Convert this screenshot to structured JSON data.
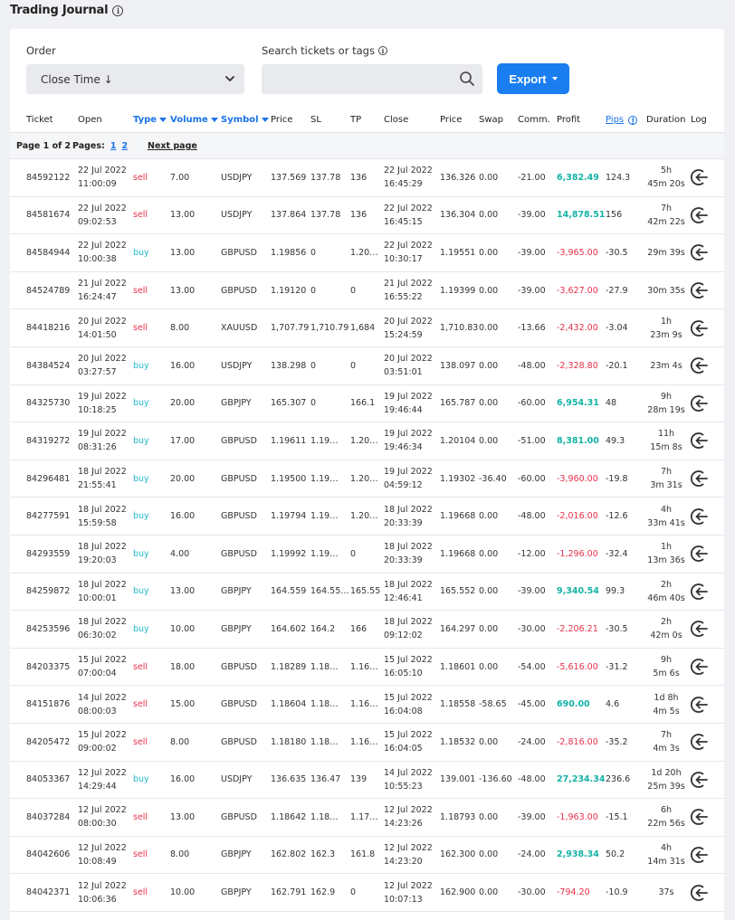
{
  "page": {
    "title": "Trading Journal"
  },
  "filters": {
    "order_label": "Order",
    "order_value": "Close Time ↓",
    "search_label": "Search tickets or tags",
    "search_value": "",
    "export_label": "Export"
  },
  "columns": {
    "ticket": "Ticket",
    "open": "Open",
    "type": "Type",
    "volume": "Volume",
    "symbol": "Symbol",
    "price": "Price",
    "sl": "SL",
    "tp": "TP",
    "close": "Close",
    "close_price": "Price",
    "swap": "Swap",
    "comm": "Comm.",
    "profit": "Profit",
    "pips": "Pips",
    "duration": "Duration",
    "log": "Log"
  },
  "pagination": {
    "info": "Page 1 of 2",
    "pages_label": "Pages:",
    "pages": [
      "1",
      "2"
    ],
    "next": "Next page"
  },
  "colors": {
    "accent": "#1a7ef0",
    "sell": "#e8304a",
    "buy": "#22b8c9",
    "profit_pos": "#14b3a5",
    "profit_neg": "#e8304a"
  },
  "trades": [
    {
      "ticket": "84592122",
      "open_date": "22 Jul 2022",
      "open_time": "11:00:09",
      "type": "sell",
      "volume": "7.00",
      "symbol": "USDJPY",
      "price": "137.569",
      "sl": "137.78",
      "tp": "136",
      "close_date": "22 Jul 2022",
      "close_time": "16:45:29",
      "close_price": "136.326",
      "swap": "0.00",
      "comm": "-21.00",
      "profit": "6,382.49",
      "pips": "124.3",
      "dur1": "5h",
      "dur2": "45m 20s"
    },
    {
      "ticket": "84581674",
      "open_date": "22 Jul 2022",
      "open_time": "09:02:53",
      "type": "sell",
      "volume": "13.00",
      "symbol": "USDJPY",
      "price": "137.864",
      "sl": "137.78",
      "tp": "136",
      "close_date": "22 Jul 2022",
      "close_time": "16:45:15",
      "close_price": "136.304",
      "swap": "0.00",
      "comm": "-39.00",
      "profit": "14,878.51",
      "pips": "156",
      "dur1": "7h",
      "dur2": "42m 22s"
    },
    {
      "ticket": "84584944",
      "open_date": "22 Jul 2022",
      "open_time": "10:00:38",
      "type": "buy",
      "volume": "13.00",
      "symbol": "GBPUSD",
      "price": "1.19856",
      "sl": "0",
      "tp": "1.20…",
      "close_date": "22 Jul 2022",
      "close_time": "10:30:17",
      "close_price": "1.19551",
      "swap": "0.00",
      "comm": "-39.00",
      "profit": "-3,965.00",
      "pips": "-30.5",
      "dur1": "29m 39s",
      "dur2": ""
    },
    {
      "ticket": "84524789",
      "open_date": "21 Jul 2022",
      "open_time": "16:24:47",
      "type": "sell",
      "volume": "13.00",
      "symbol": "GBPUSD",
      "price": "1.19120",
      "sl": "0",
      "tp": "0",
      "close_date": "21 Jul 2022",
      "close_time": "16:55:22",
      "close_price": "1.19399",
      "swap": "0.00",
      "comm": "-39.00",
      "profit": "-3,627.00",
      "pips": "-27.9",
      "dur1": "30m 35s",
      "dur2": ""
    },
    {
      "ticket": "84418216",
      "open_date": "20 Jul 2022",
      "open_time": "14:01:50",
      "type": "sell",
      "volume": "8.00",
      "symbol": "XAUUSD",
      "price": "1,707.79",
      "sl": "1,710.79",
      "tp": "1,684",
      "close_date": "20 Jul 2022",
      "close_time": "15:24:59",
      "close_price": "1,710.83",
      "swap": "0.00",
      "comm": "-13.66",
      "profit": "-2,432.00",
      "pips": "-3.04",
      "dur1": "1h",
      "dur2": "23m 9s"
    },
    {
      "ticket": "84384524",
      "open_date": "20 Jul 2022",
      "open_time": "03:27:57",
      "type": "buy",
      "volume": "16.00",
      "symbol": "USDJPY",
      "price": "138.298",
      "sl": "0",
      "tp": "0",
      "close_date": "20 Jul 2022",
      "close_time": "03:51:01",
      "close_price": "138.097",
      "swap": "0.00",
      "comm": "-48.00",
      "profit": "-2,328.80",
      "pips": "-20.1",
      "dur1": "23m 4s",
      "dur2": ""
    },
    {
      "ticket": "84325730",
      "open_date": "19 Jul 2022",
      "open_time": "10:18:25",
      "type": "buy",
      "volume": "20.00",
      "symbol": "GBPJPY",
      "price": "165.307",
      "sl": "0",
      "tp": "166.1",
      "close_date": "19 Jul 2022",
      "close_time": "19:46:44",
      "close_price": "165.787",
      "swap": "0.00",
      "comm": "-60.00",
      "profit": "6,954.31",
      "pips": "48",
      "dur1": "9h",
      "dur2": "28m 19s"
    },
    {
      "ticket": "84319272",
      "open_date": "19 Jul 2022",
      "open_time": "08:31:26",
      "type": "buy",
      "volume": "17.00",
      "symbol": "GBPUSD",
      "price": "1.19611",
      "sl": "1.19…",
      "tp": "1.20…",
      "close_date": "19 Jul 2022",
      "close_time": "19:46:34",
      "close_price": "1.20104",
      "swap": "0.00",
      "comm": "-51.00",
      "profit": "8,381.00",
      "pips": "49.3",
      "dur1": "11h",
      "dur2": "15m 8s"
    },
    {
      "ticket": "84296481",
      "open_date": "18 Jul 2022",
      "open_time": "21:55:41",
      "type": "buy",
      "volume": "20.00",
      "symbol": "GBPUSD",
      "price": "1.19500",
      "sl": "1.19…",
      "tp": "1.20…",
      "close_date": "19 Jul 2022",
      "close_time": "04:59:12",
      "close_price": "1.19302",
      "swap": "-36.40",
      "comm": "-60.00",
      "profit": "-3,960.00",
      "pips": "-19.8",
      "dur1": "7h",
      "dur2": "3m 31s"
    },
    {
      "ticket": "84277591",
      "open_date": "18 Jul 2022",
      "open_time": "15:59:58",
      "type": "buy",
      "volume": "16.00",
      "symbol": "GBPUSD",
      "price": "1.19794",
      "sl": "1.19…",
      "tp": "1.20…",
      "close_date": "18 Jul 2022",
      "close_time": "20:33:39",
      "close_price": "1.19668",
      "swap": "0.00",
      "comm": "-48.00",
      "profit": "-2,016.00",
      "pips": "-12.6",
      "dur1": "4h",
      "dur2": "33m 41s"
    },
    {
      "ticket": "84293559",
      "open_date": "18 Jul 2022",
      "open_time": "19:20:03",
      "type": "buy",
      "volume": "4.00",
      "symbol": "GBPUSD",
      "price": "1.19992",
      "sl": "1.19…",
      "tp": "0",
      "close_date": "18 Jul 2022",
      "close_time": "20:33:39",
      "close_price": "1.19668",
      "swap": "0.00",
      "comm": "-12.00",
      "profit": "-1,296.00",
      "pips": "-32.4",
      "dur1": "1h",
      "dur2": "13m 36s"
    },
    {
      "ticket": "84259872",
      "open_date": "18 Jul 2022",
      "open_time": "10:00:01",
      "type": "buy",
      "volume": "13.00",
      "symbol": "GBPJPY",
      "price": "164.559",
      "sl": "164.55…",
      "tp": "165.55",
      "close_date": "18 Jul 2022",
      "close_time": "12:46:41",
      "close_price": "165.552",
      "swap": "0.00",
      "comm": "-39.00",
      "profit": "9,340.54",
      "pips": "99.3",
      "dur1": "2h",
      "dur2": "46m 40s"
    },
    {
      "ticket": "84253596",
      "open_date": "18 Jul 2022",
      "open_time": "06:30:02",
      "type": "buy",
      "volume": "10.00",
      "symbol": "GBPJPY",
      "price": "164.602",
      "sl": "164.2",
      "tp": "166",
      "close_date": "18 Jul 2022",
      "close_time": "09:12:02",
      "close_price": "164.297",
      "swap": "0.00",
      "comm": "-30.00",
      "profit": "-2,206.21",
      "pips": "-30.5",
      "dur1": "2h",
      "dur2": "42m 0s"
    },
    {
      "ticket": "84203375",
      "open_date": "15 Jul 2022",
      "open_time": "07:00:04",
      "type": "sell",
      "volume": "18.00",
      "symbol": "GBPUSD",
      "price": "1.18289",
      "sl": "1.18…",
      "tp": "1.16…",
      "close_date": "15 Jul 2022",
      "close_time": "16:05:10",
      "close_price": "1.18601",
      "swap": "0.00",
      "comm": "-54.00",
      "profit": "-5,616.00",
      "pips": "-31.2",
      "dur1": "9h",
      "dur2": "5m 6s"
    },
    {
      "ticket": "84151876",
      "open_date": "14 Jul 2022",
      "open_time": "08:00:03",
      "type": "sell",
      "volume": "15.00",
      "symbol": "GBPUSD",
      "price": "1.18604",
      "sl": "1.18…",
      "tp": "1.16…",
      "close_date": "15 Jul 2022",
      "close_time": "16:04:08",
      "close_price": "1.18558",
      "swap": "-58.65",
      "comm": "-45.00",
      "profit": "690.00",
      "pips": "4.6",
      "dur1": "1d 8h",
      "dur2": "4m 5s"
    },
    {
      "ticket": "84205472",
      "open_date": "15 Jul 2022",
      "open_time": "09:00:02",
      "type": "sell",
      "volume": "8.00",
      "symbol": "GBPUSD",
      "price": "1.18180",
      "sl": "1.18…",
      "tp": "1.16…",
      "close_date": "15 Jul 2022",
      "close_time": "16:04:05",
      "close_price": "1.18532",
      "swap": "0.00",
      "comm": "-24.00",
      "profit": "-2,816.00",
      "pips": "-35.2",
      "dur1": "7h",
      "dur2": "4m 3s"
    },
    {
      "ticket": "84053367",
      "open_date": "12 Jul 2022",
      "open_time": "14:29:44",
      "type": "buy",
      "volume": "16.00",
      "symbol": "USDJPY",
      "price": "136.635",
      "sl": "136.47",
      "tp": "139",
      "close_date": "14 Jul 2022",
      "close_time": "10:55:23",
      "close_price": "139.001",
      "swap": "-136.60",
      "comm": "-48.00",
      "profit": "27,234.34",
      "pips": "236.6",
      "dur1": "1d 20h",
      "dur2": "25m 39s"
    },
    {
      "ticket": "84037284",
      "open_date": "12 Jul 2022",
      "open_time": "08:00:30",
      "type": "sell",
      "volume": "13.00",
      "symbol": "GBPUSD",
      "price": "1.18642",
      "sl": "1.18…",
      "tp": "1.17…",
      "close_date": "12 Jul 2022",
      "close_time": "14:23:26",
      "close_price": "1.18793",
      "swap": "0.00",
      "comm": "-39.00",
      "profit": "-1,963.00",
      "pips": "-15.1",
      "dur1": "6h",
      "dur2": "22m 56s"
    },
    {
      "ticket": "84042606",
      "open_date": "12 Jul 2022",
      "open_time": "10:08:49",
      "type": "sell",
      "volume": "8.00",
      "symbol": "GBPJPY",
      "price": "162.802",
      "sl": "162.3",
      "tp": "161.8",
      "close_date": "12 Jul 2022",
      "close_time": "14:23:20",
      "close_price": "162.300",
      "swap": "0.00",
      "comm": "-24.00",
      "profit": "2,938.34",
      "pips": "50.2",
      "dur1": "4h",
      "dur2": "14m 31s"
    },
    {
      "ticket": "84042371",
      "open_date": "12 Jul 2022",
      "open_time": "10:06:36",
      "type": "sell",
      "volume": "10.00",
      "symbol": "GBPJPY",
      "price": "162.791",
      "sl": "162.9",
      "tp": "0",
      "close_date": "12 Jul 2022",
      "close_time": "10:07:13",
      "close_price": "162.900",
      "swap": "0.00",
      "comm": "-30.00",
      "profit": "-794.20",
      "pips": "-10.9",
      "dur1": "37s",
      "dur2": ""
    }
  ]
}
